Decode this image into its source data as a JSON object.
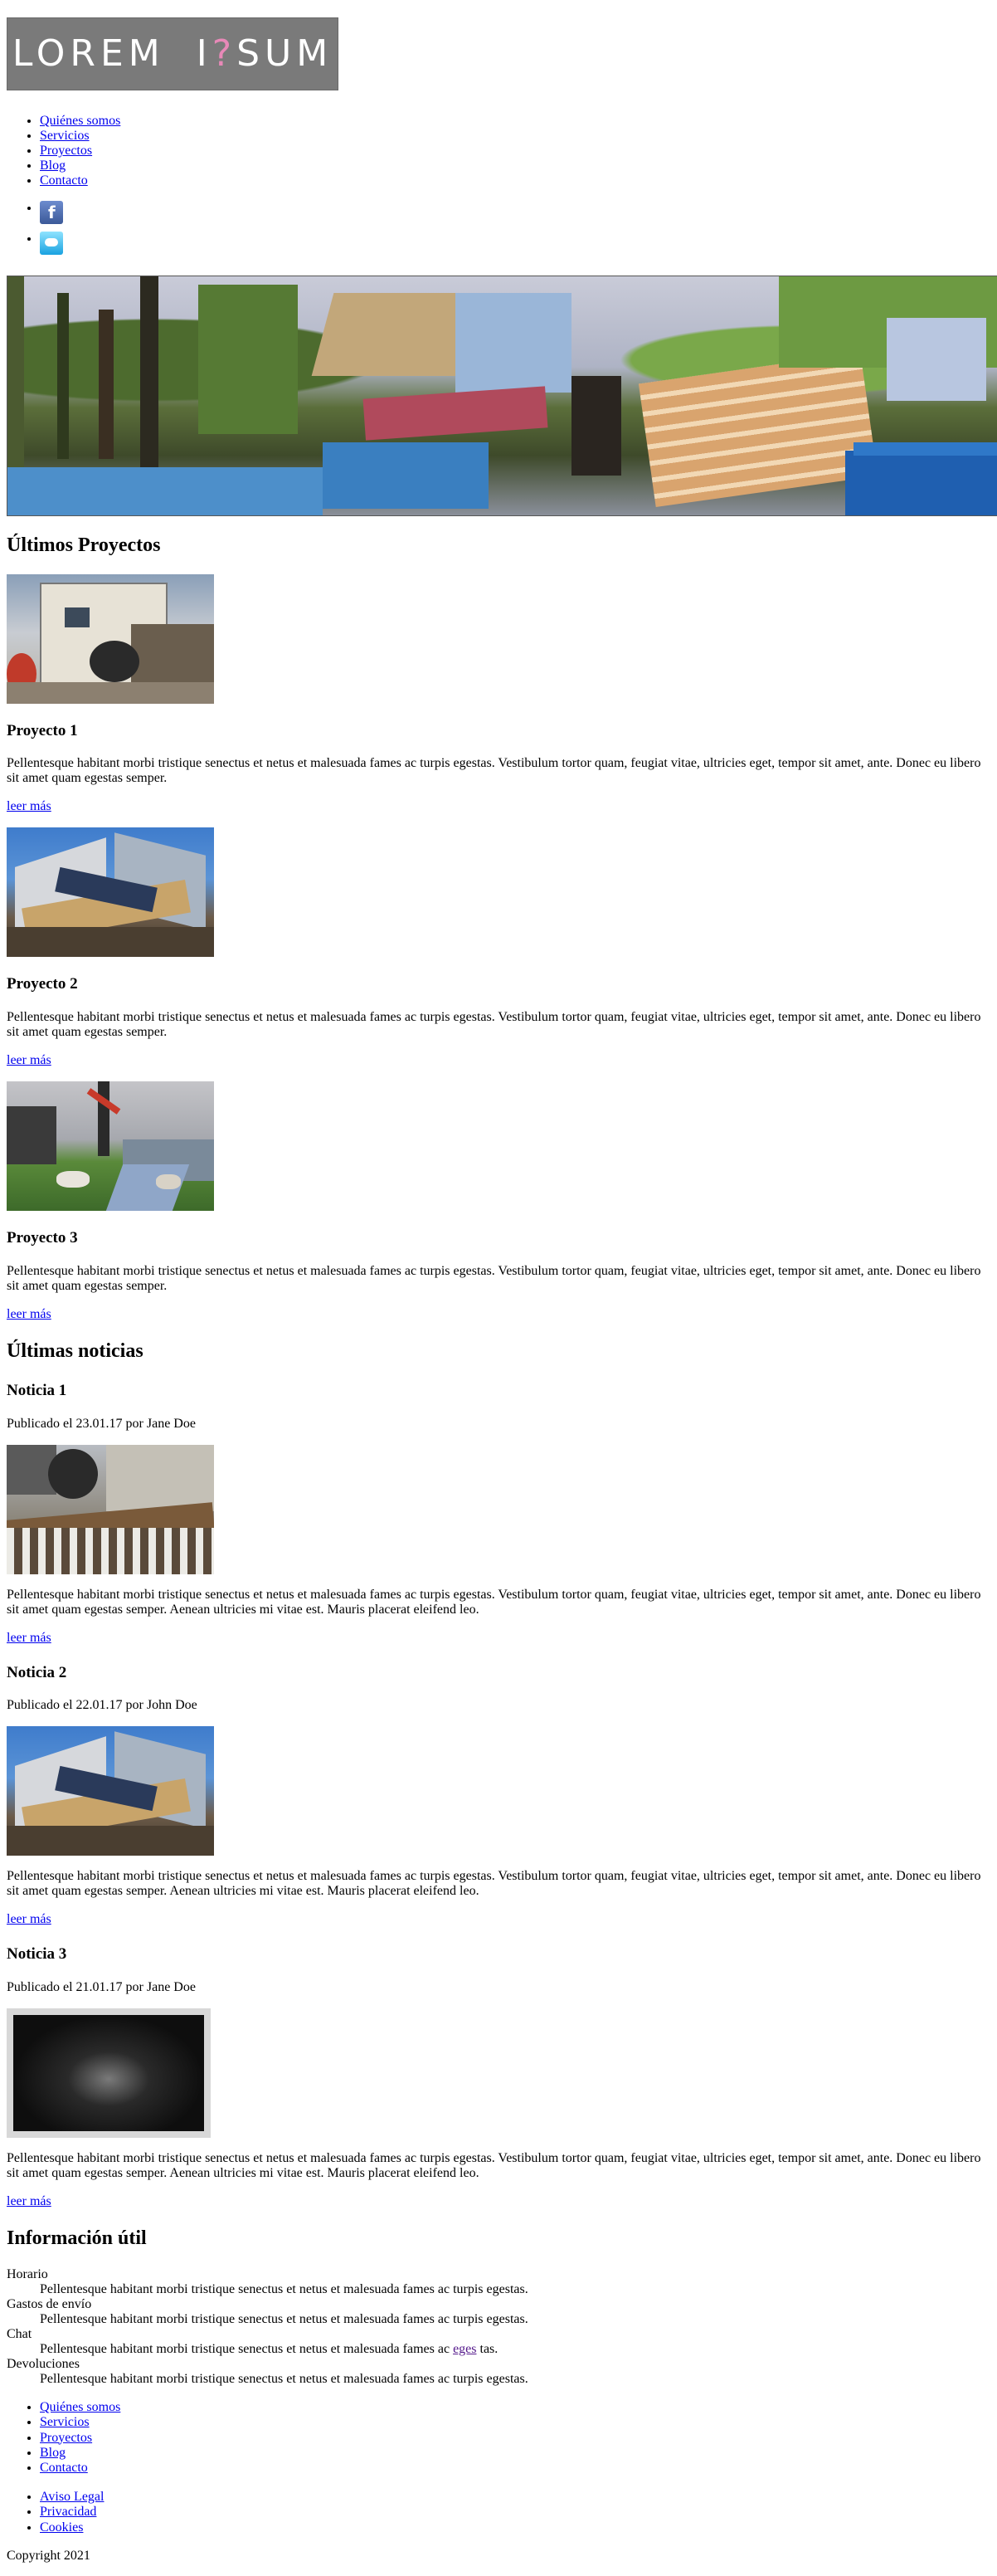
{
  "logo": {
    "part1": "LOREM",
    "part2a": "I",
    "part2q": "?",
    "part2b": "SUM"
  },
  "nav": [
    "Quiénes somos",
    "Servicios",
    "Proyectos",
    "Blog",
    "Contacto"
  ],
  "social": [
    "facebook-icon",
    "twitter-icon"
  ],
  "projects": {
    "heading": "Últimos Proyectos",
    "items": [
      {
        "title": "Proyecto 1",
        "text": "Pellentesque habitant morbi tristique senectus et netus et malesuada fames ac turpis egestas. Vestibulum tortor quam, feugiat vitae, ultricies eget, tempor sit amet, ante. Donec eu libero sit amet quam egestas semper.",
        "link": "leer más"
      },
      {
        "title": "Proyecto 2",
        "text": "Pellentesque habitant morbi tristique senectus et netus et malesuada fames ac turpis egestas. Vestibulum tortor quam, feugiat vitae, ultricies eget, tempor sit amet, ante. Donec eu libero sit amet quam egestas semper.",
        "link": "leer más"
      },
      {
        "title": "Proyecto 3",
        "text": "Pellentesque habitant morbi tristique senectus et netus et malesuada fames ac turpis egestas. Vestibulum tortor quam, feugiat vitae, ultricies eget, tempor sit amet, ante. Donec eu libero sit amet quam egestas semper.",
        "link": "leer más"
      }
    ]
  },
  "news": {
    "heading": "Últimas noticias",
    "items": [
      {
        "title": "Noticia 1",
        "meta": "Publicado el 23.01.17 por Jane Doe",
        "text": "Pellentesque habitant morbi tristique senectus et netus et malesuada fames ac turpis egestas. Vestibulum tortor quam, feugiat vitae, ultricies eget, tempor sit amet, ante. Donec eu libero sit amet quam egestas semper. Aenean ultricies mi vitae est. Mauris placerat eleifend leo.",
        "link": "leer más"
      },
      {
        "title": "Noticia 2",
        "meta": "Publicado el 22.01.17 por John Doe",
        "text": "Pellentesque habitant morbi tristique senectus et netus et malesuada fames ac turpis egestas. Vestibulum tortor quam, feugiat vitae, ultricies eget, tempor sit amet, ante. Donec eu libero sit amet quam egestas semper. Aenean ultricies mi vitae est. Mauris placerat eleifend leo.",
        "link": "leer más"
      },
      {
        "title": "Noticia 3",
        "meta": "Publicado el 21.01.17 por Jane Doe",
        "text": "Pellentesque habitant morbi tristique senectus et netus et malesuada fames ac turpis egestas. Vestibulum tortor quam, feugiat vitae, ultricies eget, tempor sit amet, ante. Donec eu libero sit amet quam egestas semper. Aenean ultricies mi vitae est. Mauris placerat eleifend leo.",
        "link": "leer más"
      }
    ]
  },
  "info": {
    "heading": "Información útil",
    "items": [
      {
        "term": "Horario",
        "desc": "Pellentesque habitant morbi tristique senectus et netus et malesuada fames ac turpis egestas."
      },
      {
        "term": "Gastos de envío",
        "desc": "Pellentesque habitant morbi tristique senectus et netus et malesuada fames ac turpis egestas."
      },
      {
        "term": "Chat",
        "desc_before": "Pellentesque habitant morbi tristique senectus et netus et malesuada fames ac ",
        "desc_link": "eges",
        "desc_after": " tas."
      },
      {
        "term": "Devoluciones",
        "desc": "Pellentesque habitant morbi tristique senectus et netus et malesuada fames ac turpis egestas."
      }
    ]
  },
  "footer": {
    "nav": [
      "Quiénes somos",
      "Servicios",
      "Proyectos",
      "Blog",
      "Contacto"
    ],
    "legal": [
      "Aviso Legal",
      "Privacidad",
      "Cookies"
    ],
    "copyright": "Copyright 2021"
  },
  "colors": {
    "link": "#0000ee",
    "visited_link": "#551a8b",
    "logo_bg": "#7a7a7a",
    "logo_accent": "#e889b8"
  }
}
